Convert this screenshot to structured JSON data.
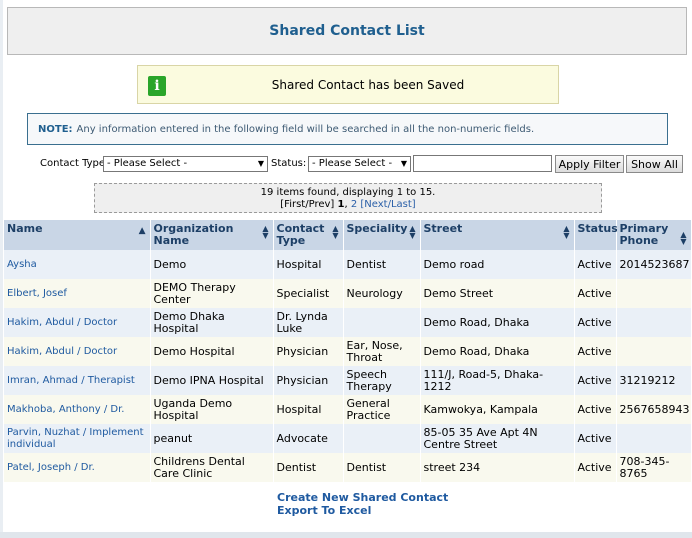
{
  "page": {
    "title": "Shared Contact List"
  },
  "message": {
    "text": "Shared Contact has been Saved",
    "icon": "info-icon"
  },
  "note": {
    "label": "NOTE:",
    "text": "Any information entered in the following field will be searched in all the non-numeric fields."
  },
  "filters": {
    "contact_type_label": "Contact Type",
    "contact_type_value": "- Please Select -",
    "status_label": "Status:",
    "status_value": "- Please Select -",
    "search_value": "",
    "apply_label": "Apply Filter",
    "show_all_label": "Show All"
  },
  "pager": {
    "summary": "19 items found, displaying 1 to 15.",
    "first_prev": "[First/Prev]",
    "current": "1",
    "page2": "2",
    "next_last": "[Next/Last]"
  },
  "table": {
    "headers": [
      "Name",
      "Organization Name",
      "Contact Type",
      "Speciality",
      "Street",
      "Status",
      "Primary Phone"
    ],
    "rows": [
      [
        "Aysha",
        "Demo",
        "Hospital",
        "Dentist",
        "Demo road",
        "Active",
        "2014523687"
      ],
      [
        "Elbert, Josef",
        "DEMO Therapy Center",
        "Specialist",
        "Neurology",
        "Demo Street",
        "Active",
        ""
      ],
      [
        "Hakim, Abdul / Doctor",
        "Demo Dhaka Hospital",
        "Dr. Lynda Luke",
        "",
        "Demo Road, Dhaka",
        "Active",
        ""
      ],
      [
        "Hakim, Abdul / Doctor",
        "Demo Hospital",
        "Physician",
        "Ear, Nose, Throat",
        "Demo Road, Dhaka",
        "Active",
        ""
      ],
      [
        "Imran, Ahmad / Therapist",
        "Demo IPNA Hospital",
        "Physician",
        "Speech Therapy",
        "111/J, Road-5, Dhaka-1212",
        "Active",
        "31219212"
      ],
      [
        "Makhoba, Anthony / Dr.",
        "Uganda Demo Hospital",
        "Hospital",
        "General Practice",
        "Kamwokya, Kampala",
        "Active",
        "2567658943"
      ],
      [
        "Parvin, Nuzhat / Implement individual",
        "peanut",
        "Advocate",
        "",
        "85-05 35 Ave Apt 4N Centre Street",
        "Active",
        ""
      ],
      [
        "Patel, Joseph / Dr.",
        "Childrens Dental Care Clinic",
        "Dentist",
        "Dentist",
        "street 234",
        "Active",
        "708-345-8765"
      ]
    ]
  },
  "links": {
    "create": "Create New Shared Contact",
    "export": "Export To Excel"
  }
}
